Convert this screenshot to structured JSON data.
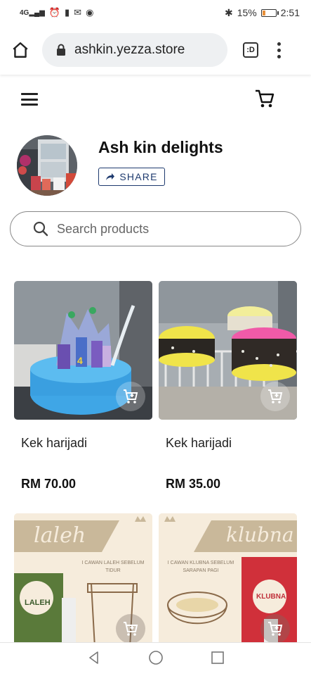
{
  "status_bar": {
    "network": "4G",
    "battery": "15%",
    "time": "2:51"
  },
  "browser": {
    "url": "ashkin.yezza.store",
    "tabs_label": ":D"
  },
  "store": {
    "name": "Ash kin delights",
    "share_label": "SHARE"
  },
  "search": {
    "placeholder": "Search products"
  },
  "products": [
    {
      "title": "Kek harijadi",
      "price": "RM 70.00"
    },
    {
      "title": "Kek harijadi",
      "price": "RM 35.00"
    },
    {
      "banner": "laleh",
      "subtitle": "I CAWAN LALEH SEBELUM TIDUR",
      "badge": "LALEH"
    },
    {
      "banner": "klubna",
      "subtitle": "I CAWAN KLUBNA SEBELUM SARAPAN PAGI",
      "badge": "KLUBNA"
    }
  ],
  "colors": {
    "share_border": "#1e3a6e",
    "url_bg": "#eef0f2",
    "banner_tan": "#c9b89a",
    "card_bg": "#f6ecdc"
  }
}
